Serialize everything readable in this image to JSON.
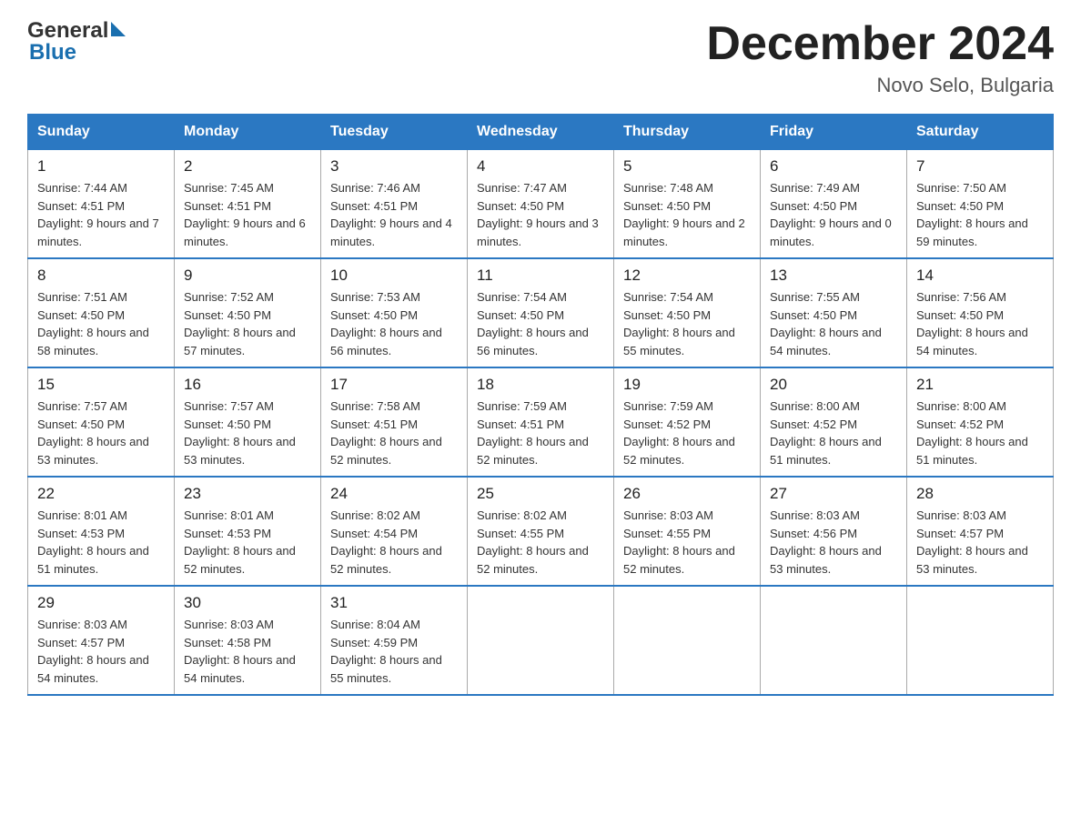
{
  "header": {
    "logo_general": "General",
    "logo_blue": "Blue",
    "month_title": "December 2024",
    "location": "Novo Selo, Bulgaria"
  },
  "weekdays": [
    "Sunday",
    "Monday",
    "Tuesday",
    "Wednesday",
    "Thursday",
    "Friday",
    "Saturday"
  ],
  "weeks": [
    [
      {
        "day": "1",
        "sunrise": "7:44 AM",
        "sunset": "4:51 PM",
        "daylight": "9 hours and 7 minutes."
      },
      {
        "day": "2",
        "sunrise": "7:45 AM",
        "sunset": "4:51 PM",
        "daylight": "9 hours and 6 minutes."
      },
      {
        "day": "3",
        "sunrise": "7:46 AM",
        "sunset": "4:51 PM",
        "daylight": "9 hours and 4 minutes."
      },
      {
        "day": "4",
        "sunrise": "7:47 AM",
        "sunset": "4:50 PM",
        "daylight": "9 hours and 3 minutes."
      },
      {
        "day": "5",
        "sunrise": "7:48 AM",
        "sunset": "4:50 PM",
        "daylight": "9 hours and 2 minutes."
      },
      {
        "day": "6",
        "sunrise": "7:49 AM",
        "sunset": "4:50 PM",
        "daylight": "9 hours and 0 minutes."
      },
      {
        "day": "7",
        "sunrise": "7:50 AM",
        "sunset": "4:50 PM",
        "daylight": "8 hours and 59 minutes."
      }
    ],
    [
      {
        "day": "8",
        "sunrise": "7:51 AM",
        "sunset": "4:50 PM",
        "daylight": "8 hours and 58 minutes."
      },
      {
        "day": "9",
        "sunrise": "7:52 AM",
        "sunset": "4:50 PM",
        "daylight": "8 hours and 57 minutes."
      },
      {
        "day": "10",
        "sunrise": "7:53 AM",
        "sunset": "4:50 PM",
        "daylight": "8 hours and 56 minutes."
      },
      {
        "day": "11",
        "sunrise": "7:54 AM",
        "sunset": "4:50 PM",
        "daylight": "8 hours and 56 minutes."
      },
      {
        "day": "12",
        "sunrise": "7:54 AM",
        "sunset": "4:50 PM",
        "daylight": "8 hours and 55 minutes."
      },
      {
        "day": "13",
        "sunrise": "7:55 AM",
        "sunset": "4:50 PM",
        "daylight": "8 hours and 54 minutes."
      },
      {
        "day": "14",
        "sunrise": "7:56 AM",
        "sunset": "4:50 PM",
        "daylight": "8 hours and 54 minutes."
      }
    ],
    [
      {
        "day": "15",
        "sunrise": "7:57 AM",
        "sunset": "4:50 PM",
        "daylight": "8 hours and 53 minutes."
      },
      {
        "day": "16",
        "sunrise": "7:57 AM",
        "sunset": "4:50 PM",
        "daylight": "8 hours and 53 minutes."
      },
      {
        "day": "17",
        "sunrise": "7:58 AM",
        "sunset": "4:51 PM",
        "daylight": "8 hours and 52 minutes."
      },
      {
        "day": "18",
        "sunrise": "7:59 AM",
        "sunset": "4:51 PM",
        "daylight": "8 hours and 52 minutes."
      },
      {
        "day": "19",
        "sunrise": "7:59 AM",
        "sunset": "4:52 PM",
        "daylight": "8 hours and 52 minutes."
      },
      {
        "day": "20",
        "sunrise": "8:00 AM",
        "sunset": "4:52 PM",
        "daylight": "8 hours and 51 minutes."
      },
      {
        "day": "21",
        "sunrise": "8:00 AM",
        "sunset": "4:52 PM",
        "daylight": "8 hours and 51 minutes."
      }
    ],
    [
      {
        "day": "22",
        "sunrise": "8:01 AM",
        "sunset": "4:53 PM",
        "daylight": "8 hours and 51 minutes."
      },
      {
        "day": "23",
        "sunrise": "8:01 AM",
        "sunset": "4:53 PM",
        "daylight": "8 hours and 52 minutes."
      },
      {
        "day": "24",
        "sunrise": "8:02 AM",
        "sunset": "4:54 PM",
        "daylight": "8 hours and 52 minutes."
      },
      {
        "day": "25",
        "sunrise": "8:02 AM",
        "sunset": "4:55 PM",
        "daylight": "8 hours and 52 minutes."
      },
      {
        "day": "26",
        "sunrise": "8:03 AM",
        "sunset": "4:55 PM",
        "daylight": "8 hours and 52 minutes."
      },
      {
        "day": "27",
        "sunrise": "8:03 AM",
        "sunset": "4:56 PM",
        "daylight": "8 hours and 53 minutes."
      },
      {
        "day": "28",
        "sunrise": "8:03 AM",
        "sunset": "4:57 PM",
        "daylight": "8 hours and 53 minutes."
      }
    ],
    [
      {
        "day": "29",
        "sunrise": "8:03 AM",
        "sunset": "4:57 PM",
        "daylight": "8 hours and 54 minutes."
      },
      {
        "day": "30",
        "sunrise": "8:03 AM",
        "sunset": "4:58 PM",
        "daylight": "8 hours and 54 minutes."
      },
      {
        "day": "31",
        "sunrise": "8:04 AM",
        "sunset": "4:59 PM",
        "daylight": "8 hours and 55 minutes."
      },
      null,
      null,
      null,
      null
    ]
  ],
  "labels": {
    "sunrise": "Sunrise:",
    "sunset": "Sunset:",
    "daylight": "Daylight:"
  }
}
